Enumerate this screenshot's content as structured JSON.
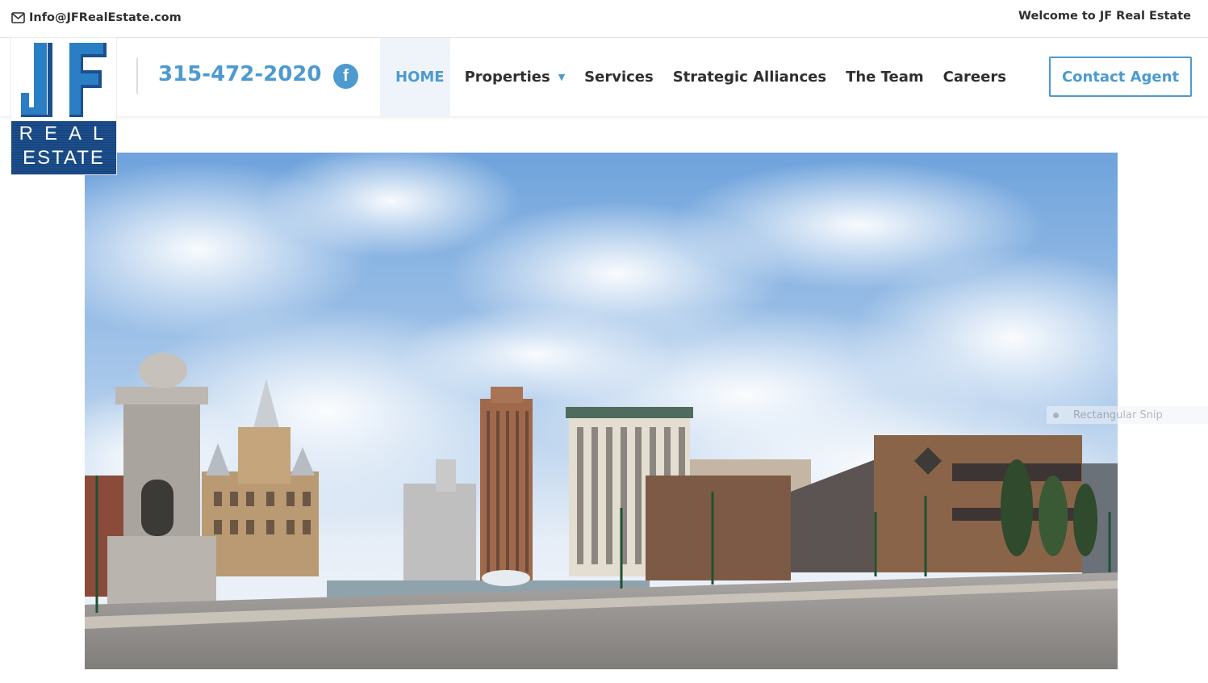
{
  "topbar": {
    "email": "Info@JFRealEstate.com",
    "welcome": "Welcome to JF Real Estate"
  },
  "logo": {
    "monogram": "JF",
    "line1": "REAL",
    "line2": "ESTATE"
  },
  "header": {
    "phone": "315-472-2020",
    "facebook_icon": "facebook-icon",
    "nav": [
      {
        "label": "HOME",
        "active": true
      },
      {
        "label": "Properties",
        "has_dropdown": true
      },
      {
        "label": "Services"
      },
      {
        "label": "Strategic Alliances"
      },
      {
        "label": "The Team"
      },
      {
        "label": "Careers"
      }
    ],
    "contact_button": "Contact Agent"
  },
  "overlay": {
    "snip_label": "Rectangular Snip"
  },
  "colors": {
    "accent": "#4d9ad0",
    "text": "#2f2f2f",
    "logo_blue": "#1c4f8e",
    "active_bg": "#eef4fa"
  }
}
